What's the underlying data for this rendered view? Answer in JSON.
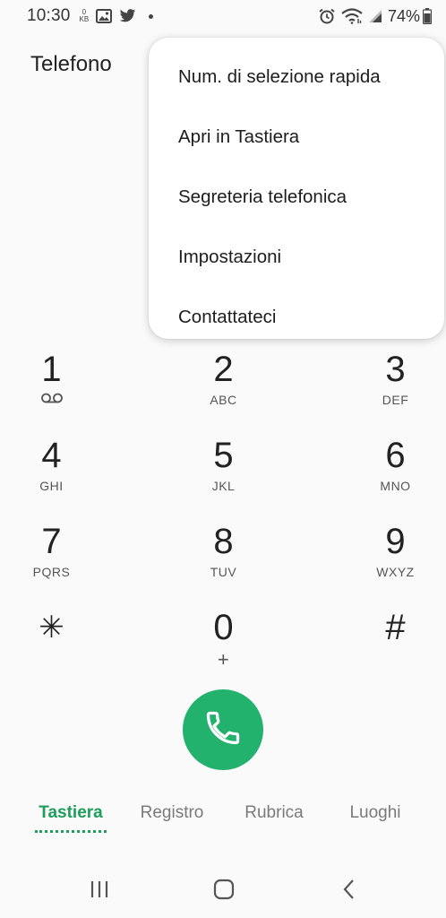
{
  "status_bar": {
    "time": "10:30",
    "kb_top": "0",
    "kb_bottom": "KB",
    "battery": "74%",
    "icons": [
      "image-icon",
      "twitter-icon",
      "alarm-icon",
      "wifi-icon",
      "signal-icon",
      "battery-icon"
    ]
  },
  "header": {
    "title": "Telefono"
  },
  "menu": {
    "items": [
      {
        "label": "Num. di selezione rapida"
      },
      {
        "label": "Apri in Tastiera"
      },
      {
        "label": "Segreteria telefonica"
      },
      {
        "label": "Impostazioni"
      },
      {
        "label": "Contattateci"
      }
    ]
  },
  "dialpad": {
    "keys": [
      {
        "digit": "1",
        "letters": ""
      },
      {
        "digit": "2",
        "letters": "ABC"
      },
      {
        "digit": "3",
        "letters": "DEF"
      },
      {
        "digit": "4",
        "letters": "GHI"
      },
      {
        "digit": "5",
        "letters": "JKL"
      },
      {
        "digit": "6",
        "letters": "MNO"
      },
      {
        "digit": "7",
        "letters": "PQRS"
      },
      {
        "digit": "8",
        "letters": "TUV"
      },
      {
        "digit": "9",
        "letters": "WXYZ"
      },
      {
        "digit": "✳",
        "letters": ""
      },
      {
        "digit": "0",
        "letters": "+"
      },
      {
        "digit": "#",
        "letters": ""
      }
    ]
  },
  "tabs": [
    {
      "label": "Tastiera",
      "active": true
    },
    {
      "label": "Registro",
      "active": false
    },
    {
      "label": "Rubrica",
      "active": false
    },
    {
      "label": "Luoghi",
      "active": false
    }
  ],
  "colors": {
    "accent": "#1e9e5a",
    "call_button": "#23b26d",
    "background": "#fafafa"
  }
}
